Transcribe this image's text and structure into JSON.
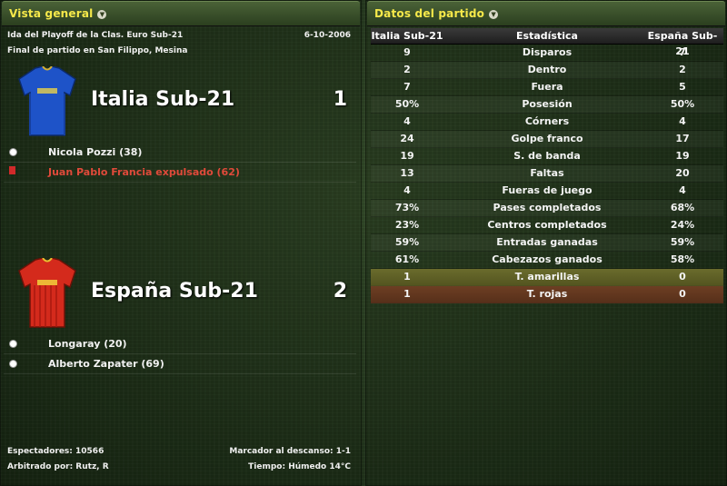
{
  "overview": {
    "title": "Vista general",
    "competition": "Ida del Playoff de la Clas. Euro Sub-21",
    "date": "6-10-2006",
    "venue": "Final de partido en San Filippo, Mesina",
    "home": {
      "name": "Italia Sub-21",
      "score": "1",
      "shirt_color": "#1e53c8",
      "events": [
        {
          "icon": "ball-icon",
          "text": "Nicola Pozzi (38)"
        },
        {
          "icon": "red-card-icon",
          "text": "Juan Pablo Francia expulsado (62)"
        }
      ]
    },
    "away": {
      "name": "España Sub-21",
      "score": "2",
      "shirt_color": "#d42a1c",
      "events": [
        {
          "icon": "ball-icon",
          "text": "Longaray (20)"
        },
        {
          "icon": "ball-icon",
          "text": "Alberto Zapater (69)"
        }
      ]
    },
    "attendance": "Espectadores: 10566",
    "referee": "Arbitrado por: Rutz, R",
    "halftime": "Marcador al descanso: 1-1",
    "weather": "Tiempo: Húmedo 14°C"
  },
  "stats": {
    "title": "Datos del partido",
    "headers": [
      "Italia Sub-21",
      "Estadística",
      "España Sub-21"
    ],
    "rows": [
      {
        "home": "9",
        "label": "Disparos",
        "away": "7"
      },
      {
        "home": "2",
        "label": "Dentro",
        "away": "2"
      },
      {
        "home": "7",
        "label": "Fuera",
        "away": "5"
      },
      {
        "home": "50%",
        "label": "Posesión",
        "away": "50%"
      },
      {
        "home": "4",
        "label": "Córners",
        "away": "4"
      },
      {
        "home": "24",
        "label": "Golpe franco",
        "away": "17"
      },
      {
        "home": "19",
        "label": "S. de banda",
        "away": "19"
      },
      {
        "home": "13",
        "label": "Faltas",
        "away": "20"
      },
      {
        "home": "4",
        "label": "Fueras de juego",
        "away": "4"
      },
      {
        "home": "73%",
        "label": "Pases completados",
        "away": "68%"
      },
      {
        "home": "23%",
        "label": "Centros completados",
        "away": "24%"
      },
      {
        "home": "59%",
        "label": "Entradas ganadas",
        "away": "59%"
      },
      {
        "home": "61%",
        "label": "Cabezazos ganados",
        "away": "58%"
      },
      {
        "home": "1",
        "label": "T. amarillas",
        "away": "0"
      },
      {
        "home": "1",
        "label": "T. rojas",
        "away": "0"
      }
    ]
  }
}
